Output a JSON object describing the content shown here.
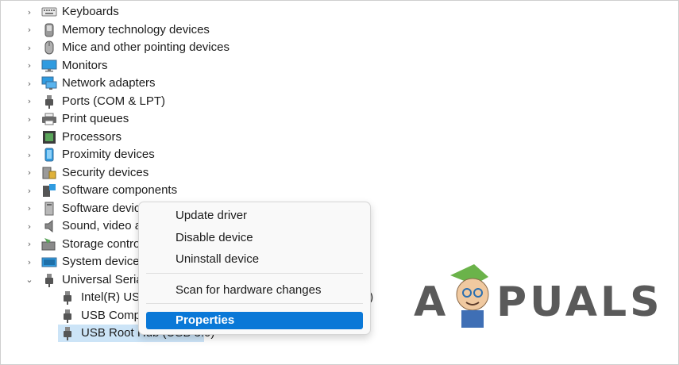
{
  "tree": {
    "items": [
      {
        "label": "Keyboards",
        "icon": "keyboard-icon"
      },
      {
        "label": "Memory technology devices",
        "icon": "memory-card-icon"
      },
      {
        "label": "Mice and other pointing devices",
        "icon": "mouse-icon"
      },
      {
        "label": "Monitors",
        "icon": "monitor-icon"
      },
      {
        "label": "Network adapters",
        "icon": "network-adapter-icon"
      },
      {
        "label": "Ports (COM & LPT)",
        "icon": "port-icon"
      },
      {
        "label": "Print queues",
        "icon": "printer-icon"
      },
      {
        "label": "Processors",
        "icon": "processor-icon"
      },
      {
        "label": "Proximity devices",
        "icon": "proximity-icon"
      },
      {
        "label": "Security devices",
        "icon": "security-icon"
      },
      {
        "label": "Software components",
        "icon": "software-component-icon"
      },
      {
        "label": "Software device",
        "icon": "software-device-icon"
      },
      {
        "label": "Sound, video a",
        "icon": "speaker-icon"
      },
      {
        "label": "Storage contro",
        "icon": "storage-icon"
      },
      {
        "label": "System devices",
        "icon": "system-icon"
      },
      {
        "label": "Universal Seria",
        "icon": "usb-icon",
        "expanded": true
      }
    ],
    "children": [
      {
        "label": "Intel(R) USB",
        "trail": "t)",
        "icon": "usb-plug-icon"
      },
      {
        "label": "USB Compo",
        "icon": "usb-plug-icon"
      },
      {
        "label": "USB Root Hub (USB 3.0)",
        "icon": "usb-plug-icon",
        "selected": true
      }
    ]
  },
  "context_menu": {
    "update_driver": "Update driver",
    "disable_device": "Disable device",
    "uninstall_device": "Uninstall device",
    "scan": "Scan for hardware changes",
    "properties": "Properties"
  },
  "watermark": {
    "left": "A",
    "right": "PUALS"
  },
  "colors": {
    "menu_highlight": "#0a78d7",
    "selection": "#cce4f7"
  }
}
